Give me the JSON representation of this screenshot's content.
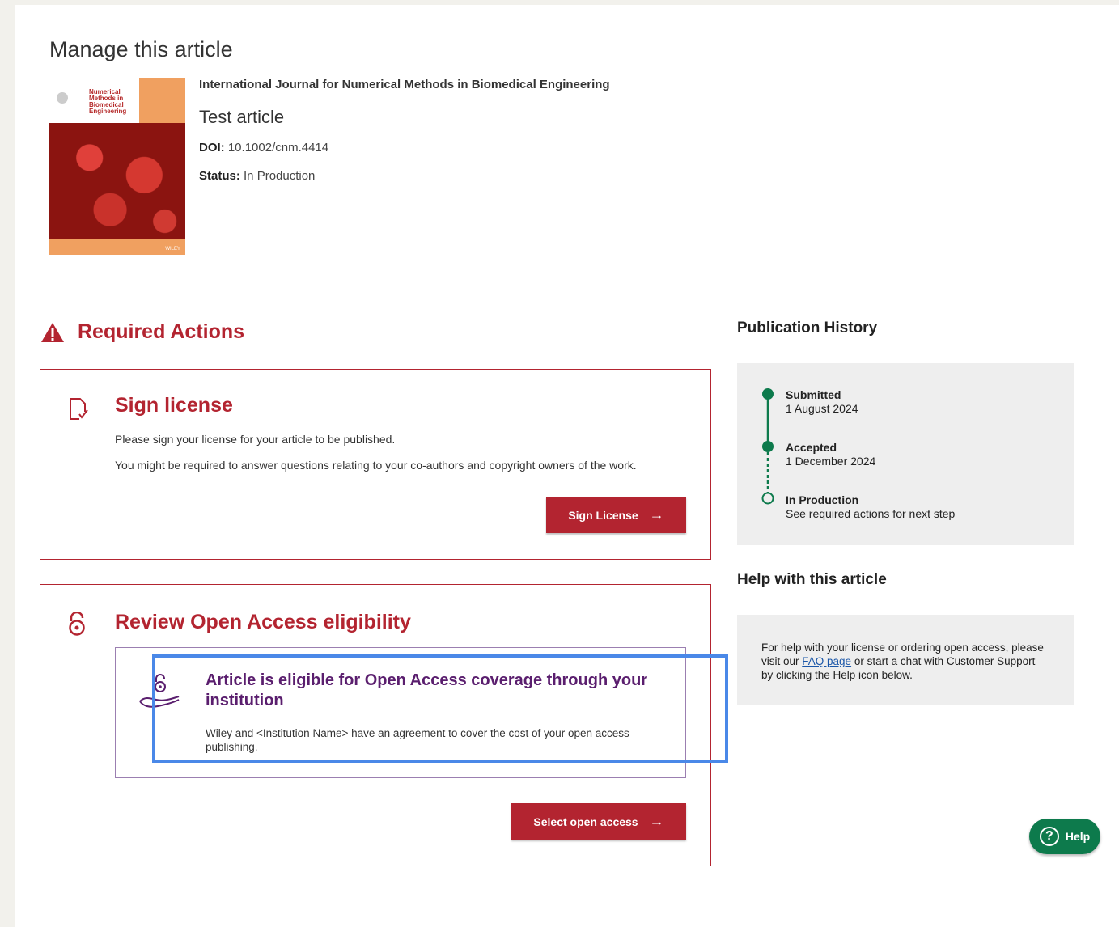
{
  "page": {
    "title": "Manage this article"
  },
  "cover": {
    "journal_text": "Numerical Methods in Biomedical Engineering",
    "publisher": "WILEY"
  },
  "article": {
    "journal": "International Journal for Numerical Methods in Biomedical Engineering",
    "title": "Test article",
    "doi_label": "DOI:",
    "doi": "10.1002/cnm.4414",
    "status_label": "Status:",
    "status": "In Production"
  },
  "required_actions": {
    "heading": "Required Actions",
    "sign_license": {
      "title": "Sign license",
      "text1": "Please sign your license for your article to be published.",
      "text2": "You might be required to answer questions relating to your co-authors and copyright owners of the work.",
      "button": "Sign License"
    },
    "open_access": {
      "title": "Review Open Access eligibility",
      "panel_title": "Article is eligible for Open Access coverage through your institution",
      "panel_text": "Wiley and <Institution Name> have an agreement to cover the cost of your open access publishing.",
      "button": "Select open access"
    }
  },
  "publication_history": {
    "heading": "Publication History",
    "steps": [
      {
        "label": "Submitted",
        "detail": "1 August 2024"
      },
      {
        "label": "Accepted",
        "detail": "1 December 2024"
      },
      {
        "label": "In Production",
        "detail": "See required actions for next step"
      }
    ]
  },
  "help_article": {
    "heading": "Help with this article",
    "text_before": "For help with your license or ordering open access, please visit our ",
    "link": "FAQ page",
    "text_after": " or start a chat with Customer Support by clicking the Help icon below."
  },
  "help_button": {
    "label": "Help",
    "glyph": "?"
  },
  "colors": {
    "brand_red": "#b32430",
    "success_green": "#0d7a4c",
    "oa_purple": "#5a1e6e",
    "highlight_blue": "#4a88e8"
  }
}
